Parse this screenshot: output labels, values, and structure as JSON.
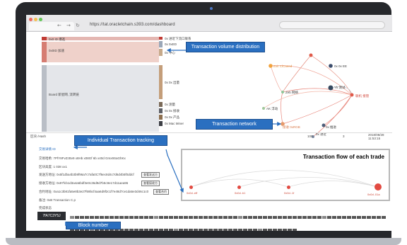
{
  "browser": {
    "url": "https://tat.oracletchain.s393.com/dashboard",
    "nav_back": "←",
    "nav_forward": "→",
    "nav_reload": "↻"
  },
  "sankey": {
    "left_nodes": [
      {
        "label": "0x0 ID 爆進"
      },
      {
        "label": "0x0ID 加速"
      },
      {
        "label": "Board 新星网, 流转链"
      }
    ],
    "right_nodes": [
      {
        "label": "0x 进近下流口联系"
      },
      {
        "label": "0x 0xED"
      },
      {
        "label": "0x 中心"
      },
      {
        "label": "0x 0x 出量"
      },
      {
        "label": "0x 测量"
      },
      {
        "label": "0x 0x 接收"
      },
      {
        "label": "0x 0x 产品"
      },
      {
        "label": "0x Mac Miner"
      }
    ],
    "colors": [
      "#c13b34",
      "#e6a49a",
      "#b7a58f",
      "#9aa7b8",
      "#d6b59a",
      "#8d6f4f"
    ]
  },
  "network": {
    "nodes": [
      {
        "label": "Exit ClCaeed",
        "color": "#f2a23c"
      },
      {
        "label": "0x 0x EE",
        "color": "#3b4c6b"
      },
      {
        "label": "Yk 测试",
        "color": "#36495f"
      },
      {
        "label": "Zeb 网络",
        "color": "#8fc79a"
      },
      {
        "label": "AK 浮动",
        "color": "#9fc79a"
      },
      {
        "label": "联机 接管",
        "color": "#e05a4a"
      },
      {
        "label": "接收 0xRGB",
        "color": "#e79a6a"
      },
      {
        "label": "0x 推进",
        "color": "#4b5d79"
      },
      {
        "label": "0x 进近",
        "color": "#7a88a0"
      }
    ]
  },
  "callouts": {
    "volume": "Transaction volume distribution",
    "network": "Transaction network",
    "individual": "Individual Transaction tracking",
    "block": "Block number"
  },
  "table_header": {
    "left": "区块 /Hash",
    "mid1": "100",
    "mid2": "3",
    "right": "2018/08/28 11:53:15"
  },
  "details": {
    "title": "交易详情 ID",
    "hash": "交易哈希: 7PfY8FvZzBv9 x8Hb x08Gf 6b x40d Gmx9SaGhKx",
    "height": "区块高度: 1 038 xx1",
    "from": "发送方地址: 0x5f1dba4b3b9f96a7c7afa0C7f6ec8d4c7d6d4b5f0ddcf",
    "from_btn": "查看发送方",
    "to": "接收方地址: 0x97fcb1d3a4a6bdf3e0c36d9d7b5c9e17d11aea96",
    "to_btn": "查看接收方",
    "contract": "合约地址: 0xa1c3b81fa5e8b3e27f69bcf4aa6d9f2c1f7e48d7ce1da5e3d46c1c0",
    "contract_btn": "查看合约",
    "memo": "备注: 0xB Transaction C.p",
    "status": "完成状态"
  },
  "flow": {
    "title": "Transaction flow of each trade",
    "nodes": [
      "0x0d..eff",
      "0x0d..b1",
      "0x0d..1f",
      "0x0d..01a"
    ]
  },
  "block_number": "7fA7C3Y5J"
}
